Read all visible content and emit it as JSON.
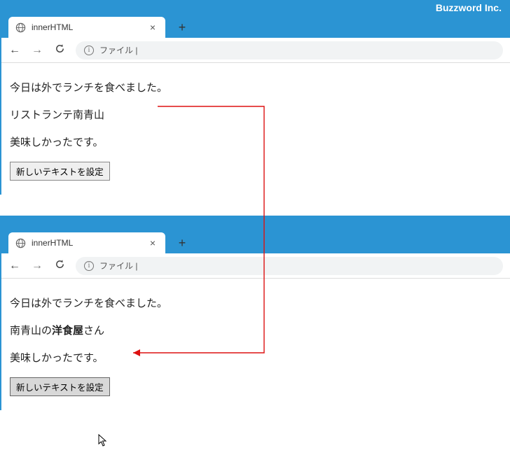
{
  "brand": "Buzzword Inc.",
  "top": {
    "tabTitle": "innerHTML",
    "addressText": "ファイル |",
    "lines": {
      "l1": "今日は外でランチを食べました。",
      "l2": "リストランテ南青山",
      "l3": "美味しかったです。"
    },
    "button": "新しいテキストを設定"
  },
  "bottom": {
    "tabTitle": "innerHTML",
    "addressText": "ファイル |",
    "lines": {
      "l1": "今日は外でランチを食べました。",
      "l2_pre": "南青山の",
      "l2_bold": "洋食屋",
      "l2_post": "さん",
      "l3": "美味しかったです。"
    },
    "button": "新しいテキストを設定"
  }
}
